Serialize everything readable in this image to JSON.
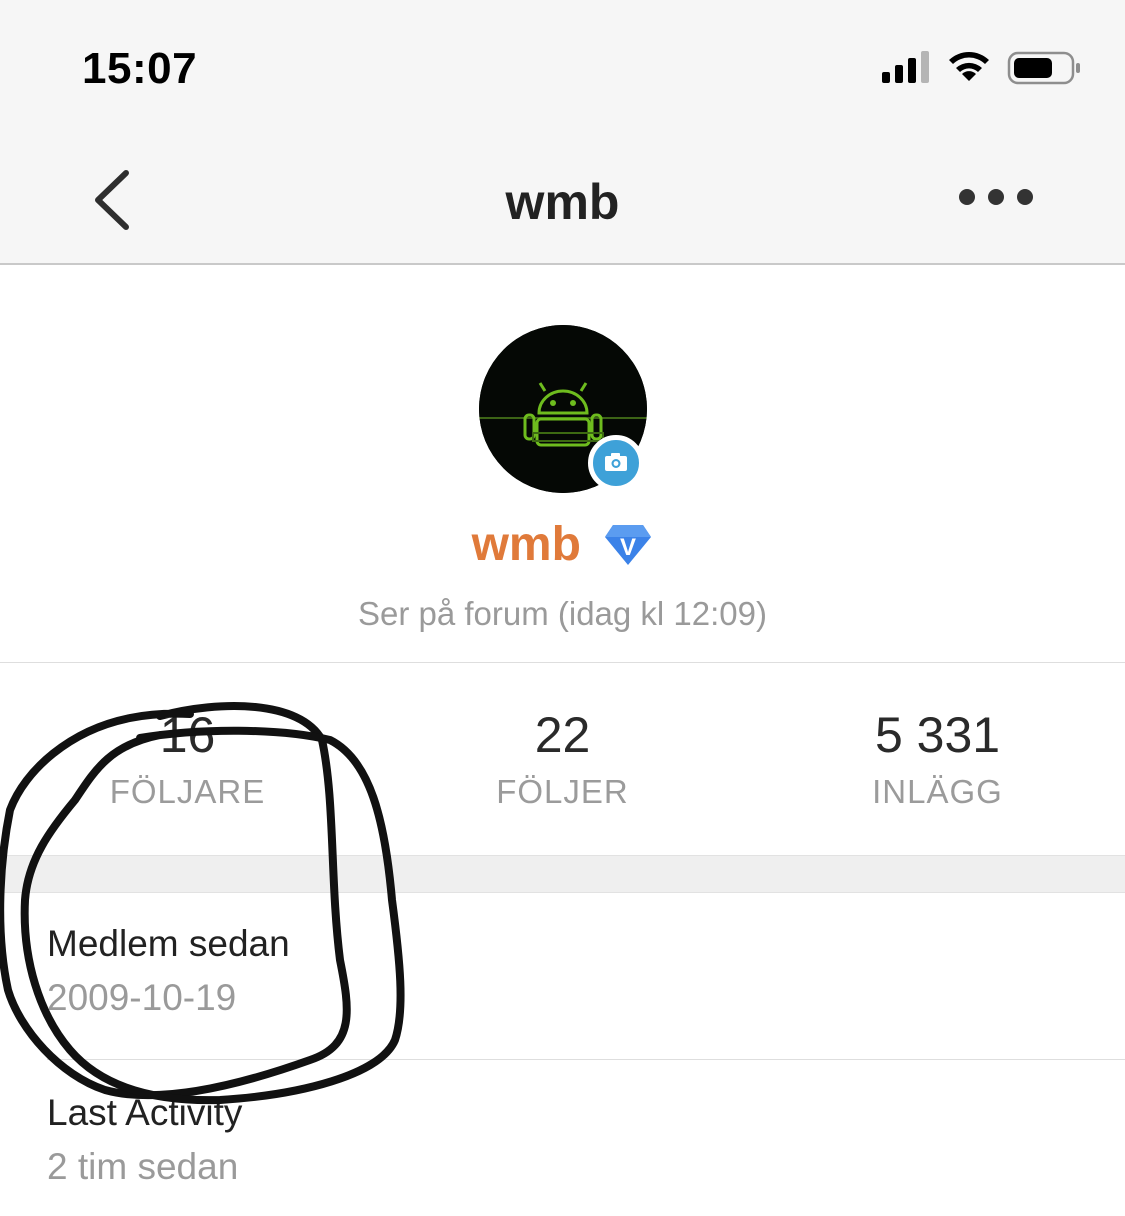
{
  "status_bar": {
    "time": "15:07",
    "icons": [
      "signal-icon",
      "wifi-icon",
      "battery-icon"
    ]
  },
  "nav": {
    "title": "wmb",
    "back_icon": "chevron-left-icon",
    "more_icon": "more-horizontal-icon"
  },
  "profile": {
    "username": "wmb",
    "presence": "Ser på forum (idag kl 12:09)",
    "badge_letter": "V",
    "avatar_icon": "android-robot-icon",
    "camera_icon": "camera-icon"
  },
  "stats": [
    {
      "value": "16",
      "label": "FÖLJARE"
    },
    {
      "value": "22",
      "label": "FÖLJER"
    },
    {
      "value": "5 331",
      "label": "INLÄGG"
    }
  ],
  "info": [
    {
      "label": "Medlem sedan",
      "value": "2009-10-19"
    },
    {
      "label": "Last Activity",
      "value": "2 tim sedan"
    }
  ],
  "colors": {
    "username": "#e07a3a",
    "badge": "#3b82e8",
    "camera_badge": "#3ea1d8",
    "bar_background": "#f6f6f6"
  }
}
